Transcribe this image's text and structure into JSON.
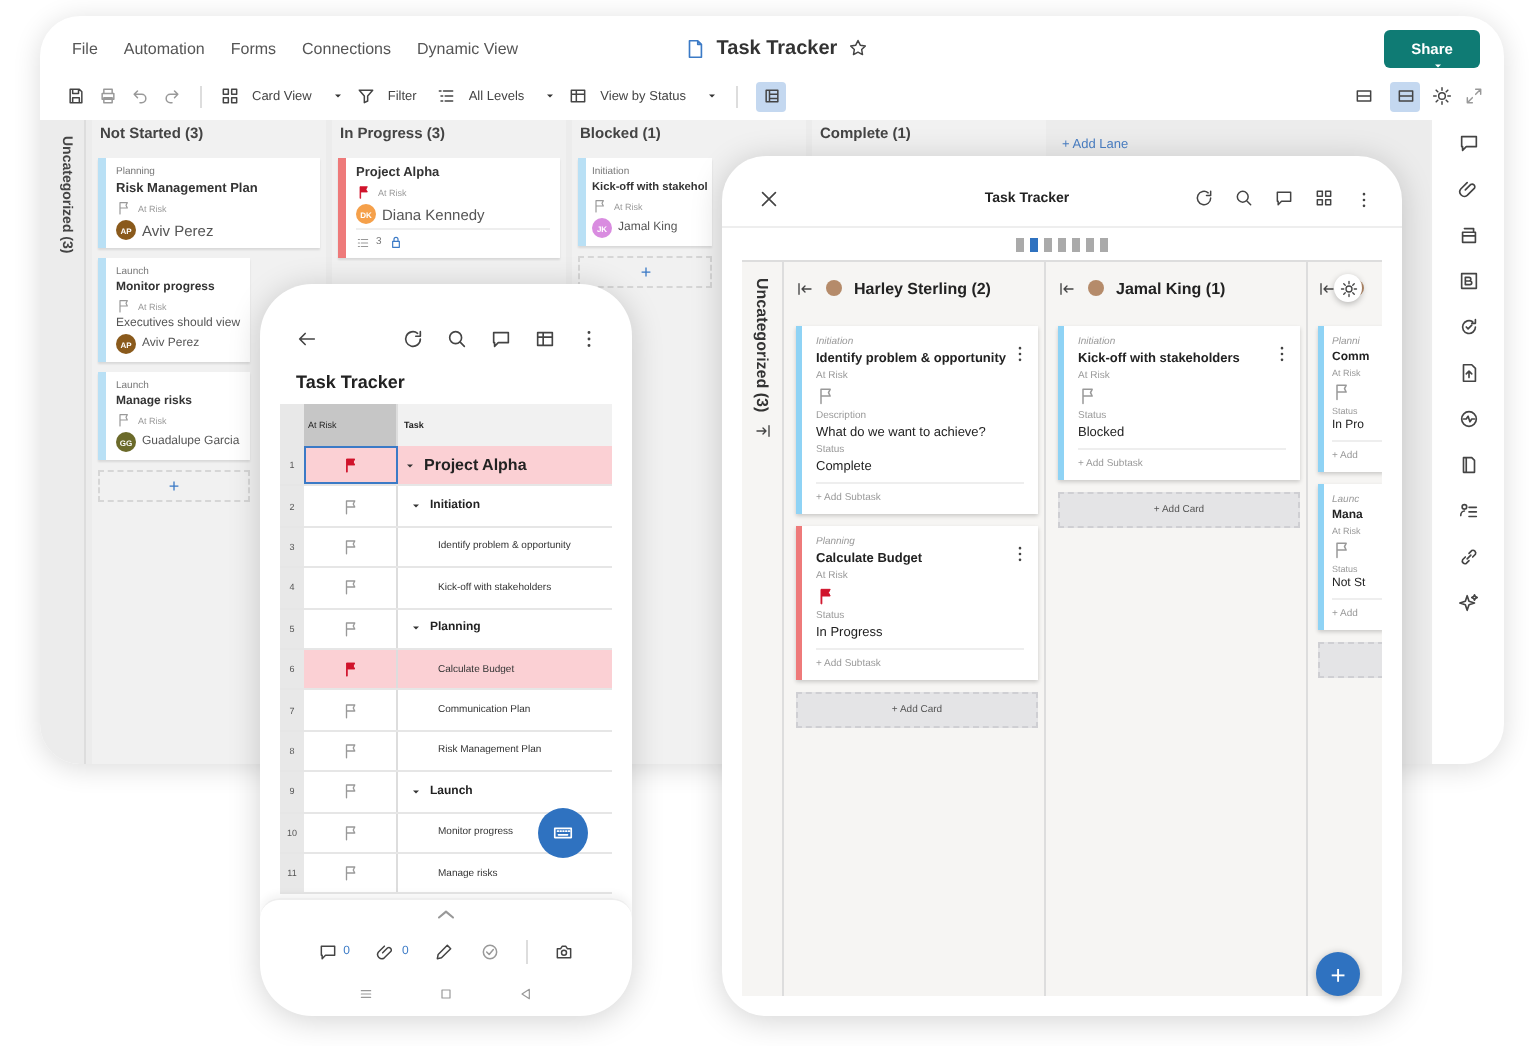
{
  "desktop": {
    "menu": [
      "File",
      "Automation",
      "Forms",
      "Connections",
      "Dynamic View"
    ],
    "title": "Task Tracker",
    "share": "Share",
    "toolbar": {
      "view": "Card View",
      "filter": "Filter",
      "levels": "All Levels",
      "group_by": "View by Status",
      "grid_toggle": {
        "selected": true
      }
    },
    "layout_toggles": [
      {
        "selected": false
      },
      {
        "selected": true
      }
    ],
    "uncategorized": "Uncategorized (3)",
    "lanes": [
      {
        "title": "Not Started (3)",
        "add": "+",
        "cards": [
          {
            "category": "Planning",
            "title": "Risk Management Plan",
            "flag_label": "At Risk",
            "at_risk": false,
            "color": "#b9e0f5",
            "assignee": {
              "initials": "AP",
              "name": "Aviv Perez",
              "color": "#8a5a1c"
            }
          },
          {
            "category": "Launch",
            "title": "Monitor progress",
            "flag_label": "At Risk",
            "at_risk": false,
            "note": "Executives should view",
            "color": "#b9e0f5",
            "assignee": {
              "initials": "AP",
              "name": "Aviv Perez",
              "color": "#8a5a1c"
            }
          },
          {
            "category": "Launch",
            "title": "Manage risks",
            "flag_label": "At Risk",
            "at_risk": false,
            "color": "#b9e0f5",
            "assignee": {
              "initials": "GG",
              "name": "Guadalupe Garcia",
              "color": "#6b6a2a"
            }
          }
        ]
      },
      {
        "title": "In Progress (3)",
        "cards": [
          {
            "title": "Project Alpha",
            "flag_label": "At Risk",
            "at_risk": true,
            "color": "#ee7a7a",
            "assignee": {
              "initials": "DK",
              "name": "Diana Kennedy",
              "color": "#f5a04a"
            },
            "subtasks": "3"
          }
        ]
      },
      {
        "title": "Blocked (1)",
        "add": "+",
        "cards": [
          {
            "category": "Initiation",
            "title": "Kick-off with stakehol",
            "flag_label": "At Risk",
            "at_risk": false,
            "color": "#b9e0f5",
            "assignee": {
              "initials": "JK",
              "name": "Jamal King",
              "color": "#d98ce0"
            }
          }
        ]
      },
      {
        "title": "Complete (1)"
      }
    ],
    "add_lane": "+ Add Lane"
  },
  "phone": {
    "title": "Task Tracker",
    "columns": [
      "At Risk",
      "Task"
    ],
    "rows": [
      {
        "num": "1",
        "task": "Project Alpha",
        "at_risk": true,
        "children": [
          {
            "num": "2",
            "task": "Initiation",
            "at_risk": false,
            "children": [
              {
                "num": "3",
                "task": "Identify problem & opportunity",
                "at_risk": false
              },
              {
                "num": "4",
                "task": "Kick-off with stakeholders",
                "at_risk": false
              }
            ]
          },
          {
            "num": "5",
            "task": "Planning",
            "at_risk": false,
            "children": [
              {
                "num": "6",
                "task": "Calculate Budget",
                "at_risk": true
              },
              {
                "num": "7",
                "task": "Communication Plan",
                "at_risk": false
              },
              {
                "num": "8",
                "task": "Risk Management Plan",
                "at_risk": false
              }
            ]
          },
          {
            "num": "9",
            "task": "Launch",
            "at_risk": false,
            "children": [
              {
                "num": "10",
                "task": "Monitor progress",
                "at_risk": false
              },
              {
                "num": "11",
                "task": "Manage risks",
                "at_risk": false
              }
            ]
          }
        ]
      }
    ],
    "comments": "0",
    "attachments": "0"
  },
  "tablet": {
    "title": "Task Tracker",
    "pages": [
      {
        "selected": false
      },
      {
        "selected": true
      },
      {
        "selected": false
      },
      {
        "selected": false
      },
      {
        "selected": false
      },
      {
        "selected": false
      },
      {
        "selected": false
      }
    ],
    "uncategorized": "Uncategorized (3)",
    "lanes": [
      {
        "title": "Harley Sterling (2)",
        "add_card": "+ Add Card",
        "cards": [
          {
            "category": "Initiation",
            "title": "Identify problem & opportunity",
            "color": "#8fd3f5",
            "fields": [
              {
                "kind": "flag",
                "label": "At Risk",
                "at_risk": false
              },
              {
                "kind": "text",
                "label": "Description",
                "value": "What do we want to achieve?"
              },
              {
                "kind": "text",
                "label": "Status",
                "value": "Complete"
              }
            ],
            "add_subtask": "+ Add Subtask"
          },
          {
            "category": "Planning",
            "title": "Calculate Budget",
            "color": "#ee7a7a",
            "fields": [
              {
                "kind": "flag",
                "label": "At Risk",
                "at_risk": true
              },
              {
                "kind": "text",
                "label": "Status",
                "value": "In Progress"
              }
            ],
            "add_subtask": "+ Add Subtask"
          }
        ]
      },
      {
        "title": "Jamal King (1)",
        "add_card": "+ Add Card",
        "cards": [
          {
            "category": "Initiation",
            "title": "Kick-off with stakeholders",
            "color": "#8fd3f5",
            "fields": [
              {
                "kind": "flag",
                "label": "At Risk",
                "at_risk": false
              },
              {
                "kind": "text",
                "label": "Status",
                "value": "Blocked"
              }
            ],
            "add_subtask": "+ Add Subtask"
          }
        ]
      },
      {
        "cards": [
          {
            "category": "Planni",
            "title": "Comm",
            "color": "#8fd3f5",
            "fields": [
              {
                "kind": "flag",
                "label": "At Risk",
                "at_risk": false
              },
              {
                "kind": "text",
                "label": "Status",
                "value": "In Pro"
              }
            ],
            "add_subtask": "+ Add"
          },
          {
            "category": "Launc",
            "title": "Mana",
            "color": "#8fd3f5",
            "fields": [
              {
                "kind": "flag",
                "label": "At Risk",
                "at_risk": false
              },
              {
                "kind": "text",
                "label": "Status",
                "value": "Not St"
              }
            ],
            "add_subtask": "+ Add"
          }
        ],
        "add_card_box": true
      }
    ],
    "fab": "+"
  }
}
